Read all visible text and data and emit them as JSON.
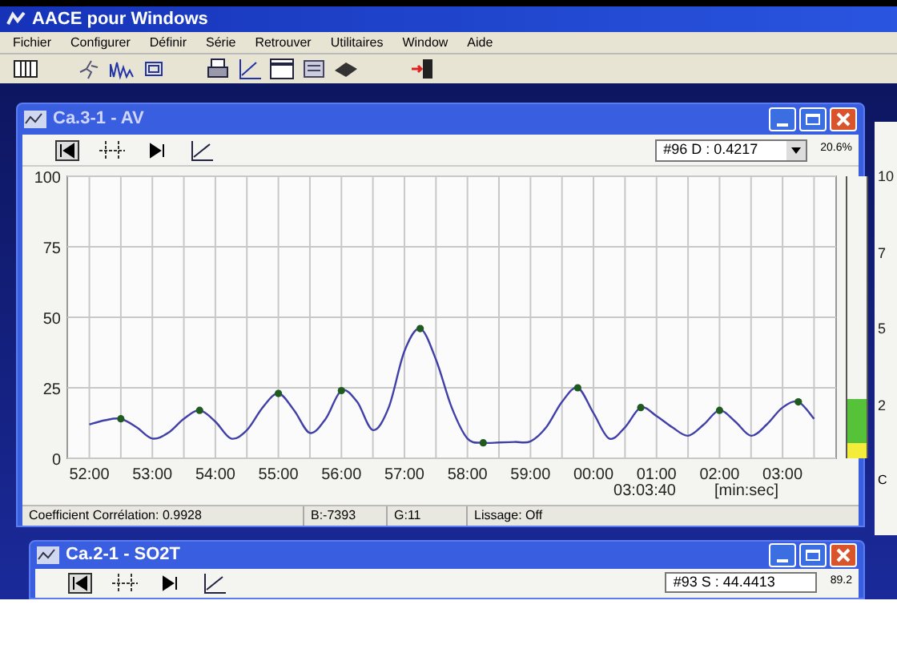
{
  "app_window": {
    "title": "AACE pour Windows"
  },
  "menu": [
    "Fichier",
    "Configurer",
    "Définir",
    "Série",
    "Retrouver",
    "Utilitaires",
    "Window",
    "Aide"
  ],
  "chart_window": {
    "title": "Ca.3-1 - AV",
    "channel_select": "#96 D : 0.4217",
    "meter_reading": "20.6%",
    "meter": {
      "level": 0.21
    },
    "chart_data": {
      "type": "line",
      "categories": [
        "52:00",
        null,
        null,
        null,
        "53:00",
        null,
        null,
        null,
        "54:00",
        null,
        null,
        null,
        "55:00",
        null,
        null,
        null,
        "56:00",
        null,
        null,
        null,
        "57:00",
        null,
        null,
        null,
        "58:00",
        null,
        null,
        null,
        "59:00",
        null,
        null,
        null,
        "00:00",
        null,
        null,
        null,
        "01:00",
        null,
        null,
        null,
        "02:00",
        null,
        null,
        null,
        "03:00",
        null,
        null
      ],
      "series": [
        {
          "color": "#4040a8",
          "values": [
            12,
            13.5,
            14,
            11,
            7,
            9,
            14,
            17,
            13,
            7,
            10,
            18,
            23,
            17,
            9,
            14,
            24,
            20,
            10,
            18,
            38,
            46,
            35,
            18,
            7,
            5.5,
            5.6,
            5.8,
            6,
            11,
            20,
            25,
            16,
            7,
            11,
            18,
            15,
            11,
            8,
            12,
            17,
            13,
            8,
            12,
            18,
            20,
            14
          ]
        }
      ],
      "ylim": [
        0,
        100
      ],
      "grid": true,
      "yticks": [
        0,
        25,
        50,
        75,
        100
      ]
    },
    "time_reading": "03:03:40",
    "x_unit": "[min:sec]",
    "status_bar": [
      "Coefficient Corrélation: 0.9928",
      "B:-7393",
      "G:11",
      "Lissage: Off"
    ]
  },
  "second_window": {
    "title": "Ca.2-1 - SO2T",
    "channel_select": "#93 S : 44.4413",
    "meter_reading": "89.2"
  },
  "background_window": {
    "axis_labels": [
      "10",
      "7",
      "5",
      "2"
    ],
    "status_text": "C"
  }
}
